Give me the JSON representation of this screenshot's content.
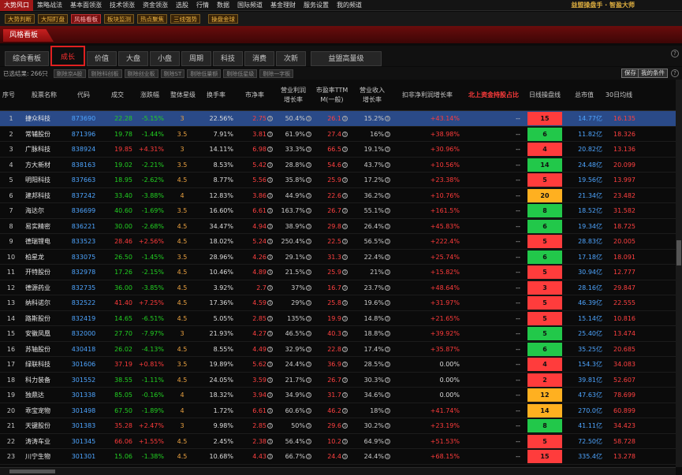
{
  "menu": [
    "大势风口",
    "策略战法",
    "基本面领涨",
    "技术领涨",
    "资金领涨",
    "选股",
    "行情",
    "数据",
    "国际频道",
    "基金理财",
    "服务设置",
    "我的频道"
  ],
  "menu_active_index": 0,
  "brand": "益盟操盘手 · 智盈大师",
  "toolbar": [
    {
      "label": "大势判断",
      "style": "gold"
    },
    {
      "label": "大阳盯盘",
      "style": "gold"
    },
    {
      "label": "风格看板",
      "style": "red"
    },
    {
      "label": "板块监测",
      "style": "gold"
    },
    {
      "label": "热点聚焦",
      "style": "gold"
    },
    {
      "label": "三线强势",
      "style": "gold"
    },
    {
      "label": "操盘金球",
      "style": "gold"
    }
  ],
  "page_tab": "风格看板",
  "tabs": [
    "综合看板",
    "成长",
    "价值",
    "大盘",
    "小盘",
    "周期",
    "科技",
    "消费",
    "次新",
    "益盟高量级"
  ],
  "active_tab_index": 1,
  "filter": {
    "selected_label": "已选结果: 266只",
    "buttons": [
      "剔除京A股",
      "剔除科创板",
      "剔除创业板",
      "剔除ST",
      "剔除低量额",
      "剔除低星级",
      "剔除一字板"
    ],
    "save_label": "保存",
    "conditions_label": "我的条件"
  },
  "columns": {
    "idx": "序号",
    "name": "股票名称",
    "code": "代码",
    "price": "成交",
    "pct": "涨跌幅",
    "star": "整体星级",
    "turnover": "换手率",
    "pb": "市净率",
    "profit_growth": "营业利润\n增长率",
    "pe": "市盈率TTM\nM(一般)",
    "revenue_growth": "营业收入\n增长率",
    "net_profit_growth": "扣非净利润增长率",
    "north_hold": "北上资金持股占比",
    "day_line": "日线操盘线",
    "market_cap": "总市值",
    "ma30": "30日均线"
  },
  "colors": {
    "up": "#ff3b3b",
    "down": "#22d022",
    "line_red": "#ff3c3c",
    "line_orange": "#ffb020",
    "line_green": "#22c84a",
    "code_blue": "#4ea5ff",
    "selected_row": "#2a4a88"
  },
  "selected_row_index": 0,
  "rows": [
    {
      "idx": "1",
      "name": "捷众科技",
      "code": "873690",
      "price": "22.28",
      "pct": "-5.15%",
      "star": "3",
      "turnover": "22.56%",
      "pb": "2.75",
      "profit_growth": "50.4%",
      "pe": "26.1",
      "revenue_growth": "15.2%",
      "net_profit_growth": "+43.14%",
      "north": "--",
      "day_line": "15",
      "day_line_color": "red",
      "market_cap": "14.77亿",
      "ma30": "16.135"
    },
    {
      "idx": "2",
      "name": "常辅股份",
      "code": "871396",
      "price": "19.78",
      "pct": "-1.44%",
      "star": "3.5",
      "turnover": "7.91%",
      "pb": "3.81",
      "profit_growth": "61.9%",
      "pe": "27.4",
      "revenue_growth": "16%",
      "net_profit_growth": "+38.98%",
      "north": "--",
      "day_line": "6",
      "day_line_color": "green",
      "market_cap": "11.82亿",
      "ma30": "18.326"
    },
    {
      "idx": "3",
      "name": "广脉科技",
      "code": "838924",
      "price": "19.85",
      "pct": "+4.31%",
      "star": "3",
      "turnover": "14.11%",
      "pb": "6.98",
      "profit_growth": "33.3%",
      "pe": "66.5",
      "revenue_growth": "19.1%",
      "net_profit_growth": "+30.96%",
      "north": "--",
      "day_line": "4",
      "day_line_color": "red",
      "market_cap": "20.82亿",
      "ma30": "13.136"
    },
    {
      "idx": "4",
      "name": "方大新材",
      "code": "838163",
      "price": "19.02",
      "pct": "-2.21%",
      "star": "3.5",
      "turnover": "8.53%",
      "pb": "5.42",
      "profit_growth": "28.8%",
      "pe": "54.6",
      "revenue_growth": "43.7%",
      "net_profit_growth": "+10.56%",
      "north": "--",
      "day_line": "14",
      "day_line_color": "green",
      "market_cap": "24.48亿",
      "ma30": "20.099"
    },
    {
      "idx": "5",
      "name": "明阳科技",
      "code": "837663",
      "price": "18.95",
      "pct": "-2.62%",
      "star": "4.5",
      "turnover": "8.77%",
      "pb": "5.56",
      "profit_growth": "35.8%",
      "pe": "25.9",
      "revenue_growth": "17.2%",
      "net_profit_growth": "+23.38%",
      "north": "--",
      "day_line": "5",
      "day_line_color": "red",
      "market_cap": "19.56亿",
      "ma30": "13.997"
    },
    {
      "idx": "6",
      "name": "建邦科技",
      "code": "837242",
      "price": "33.40",
      "pct": "-3.88%",
      "star": "4",
      "turnover": "12.83%",
      "pb": "3.86",
      "profit_growth": "44.9%",
      "pe": "22.6",
      "revenue_growth": "36.2%",
      "net_profit_growth": "+10.76%",
      "north": "--",
      "day_line": "20",
      "day_line_color": "orange",
      "market_cap": "21.34亿",
      "ma30": "23.482"
    },
    {
      "idx": "7",
      "name": "海达尔",
      "code": "836699",
      "price": "40.60",
      "pct": "-1.69%",
      "star": "3.5",
      "turnover": "16.60%",
      "pb": "6.61",
      "profit_growth": "163.7%",
      "pe": "26.7",
      "revenue_growth": "55.1%",
      "net_profit_growth": "+161.5%",
      "north": "--",
      "day_line": "8",
      "day_line_color": "green",
      "market_cap": "18.52亿",
      "ma30": "31.582"
    },
    {
      "idx": "8",
      "name": "易实精密",
      "code": "836221",
      "price": "30.00",
      "pct": "-2.68%",
      "star": "4.5",
      "turnover": "34.47%",
      "pb": "4.94",
      "profit_growth": "38.9%",
      "pe": "29.8",
      "revenue_growth": "26.4%",
      "net_profit_growth": "+45.83%",
      "north": "--",
      "day_line": "6",
      "day_line_color": "green",
      "market_cap": "19.34亿",
      "ma30": "18.725"
    },
    {
      "idx": "9",
      "name": "德瑞锂电",
      "code": "833523",
      "price": "28.46",
      "pct": "+2.56%",
      "star": "4.5",
      "turnover": "18.02%",
      "pb": "5.24",
      "profit_growth": "250.4%",
      "pe": "22.5",
      "revenue_growth": "56.5%",
      "net_profit_growth": "+222.4%",
      "north": "--",
      "day_line": "5",
      "day_line_color": "red",
      "market_cap": "28.83亿",
      "ma30": "20.005"
    },
    {
      "idx": "10",
      "name": "柏星龙",
      "code": "833075",
      "price": "26.50",
      "pct": "-1.45%",
      "star": "3.5",
      "turnover": "28.96%",
      "pb": "4.26",
      "profit_growth": "29.1%",
      "pe": "31.3",
      "revenue_growth": "22.4%",
      "net_profit_growth": "+25.74%",
      "north": "--",
      "day_line": "6",
      "day_line_color": "green",
      "market_cap": "17.18亿",
      "ma30": "18.091"
    },
    {
      "idx": "11",
      "name": "开特股份",
      "code": "832978",
      "price": "17.26",
      "pct": "-2.15%",
      "star": "4.5",
      "turnover": "10.46%",
      "pb": "4.89",
      "profit_growth": "21.5%",
      "pe": "25.9",
      "revenue_growth": "21%",
      "net_profit_growth": "+15.82%",
      "north": "--",
      "day_line": "5",
      "day_line_color": "red",
      "market_cap": "30.94亿",
      "ma30": "12.777"
    },
    {
      "idx": "12",
      "name": "德源药业",
      "code": "832735",
      "price": "36.00",
      "pct": "-3.85%",
      "star": "4.5",
      "turnover": "3.92%",
      "pb": "2.7",
      "profit_growth": "37%",
      "pe": "16.7",
      "revenue_growth": "23.7%",
      "net_profit_growth": "+48.64%",
      "north": "--",
      "day_line": "3",
      "day_line_color": "red",
      "market_cap": "28.16亿",
      "ma30": "29.847"
    },
    {
      "idx": "13",
      "name": "纳科诺尔",
      "code": "832522",
      "price": "41.40",
      "pct": "+7.25%",
      "star": "4.5",
      "turnover": "17.36%",
      "pb": "4.59",
      "profit_growth": "29%",
      "pe": "25.8",
      "revenue_growth": "19.6%",
      "net_profit_growth": "+31.97%",
      "north": "--",
      "day_line": "5",
      "day_line_color": "red",
      "market_cap": "46.39亿",
      "ma30": "22.555"
    },
    {
      "idx": "14",
      "name": "路斯股份",
      "code": "832419",
      "price": "14.65",
      "pct": "-6.51%",
      "star": "4.5",
      "turnover": "5.05%",
      "pb": "2.85",
      "profit_growth": "135%",
      "pe": "19.9",
      "revenue_growth": "14.8%",
      "net_profit_growth": "+21.65%",
      "north": "--",
      "day_line": "5",
      "day_line_color": "red",
      "market_cap": "15.14亿",
      "ma30": "10.816"
    },
    {
      "idx": "15",
      "name": "安徽凤凰",
      "code": "832000",
      "price": "27.70",
      "pct": "-7.97%",
      "star": "3",
      "turnover": "21.93%",
      "pb": "4.27",
      "profit_growth": "46.5%",
      "pe": "40.3",
      "revenue_growth": "18.8%",
      "net_profit_growth": "+39.92%",
      "north": "--",
      "day_line": "5",
      "day_line_color": "green",
      "market_cap": "25.40亿",
      "ma30": "13.474"
    },
    {
      "idx": "16",
      "name": "苏轴股份",
      "code": "430418",
      "price": "26.02",
      "pct": "-4.13%",
      "star": "4.5",
      "turnover": "8.55%",
      "pb": "4.49",
      "profit_growth": "32.9%",
      "pe": "22.8",
      "revenue_growth": "17.4%",
      "net_profit_growth": "+35.87%",
      "north": "--",
      "day_line": "6",
      "day_line_color": "green",
      "market_cap": "35.25亿",
      "ma30": "20.685"
    },
    {
      "idx": "17",
      "name": "绿联科技",
      "code": "301606",
      "price": "37.19",
      "pct": "+0.81%",
      "star": "3.5",
      "turnover": "19.89%",
      "pb": "5.62",
      "profit_growth": "24.4%",
      "pe": "36.9",
      "revenue_growth": "28.5%",
      "net_profit_growth": "0.00%",
      "north": "--",
      "day_line": "4",
      "day_line_color": "red",
      "market_cap": "154.3亿",
      "ma30": "34.083"
    },
    {
      "idx": "18",
      "name": "科力装备",
      "code": "301552",
      "price": "38.55",
      "pct": "-1.11%",
      "star": "4.5",
      "turnover": "24.05%",
      "pb": "3.59",
      "profit_growth": "21.7%",
      "pe": "26.7",
      "revenue_growth": "30.3%",
      "net_profit_growth": "0.00%",
      "north": "--",
      "day_line": "2",
      "day_line_color": "red",
      "market_cap": "39.81亿",
      "ma30": "52.607"
    },
    {
      "idx": "19",
      "name": "独鼎达",
      "code": "301338",
      "price": "85.05",
      "pct": "-0.16%",
      "star": "4",
      "turnover": "18.32%",
      "pb": "3.94",
      "profit_growth": "34.9%",
      "pe": "31.7",
      "revenue_growth": "34.6%",
      "net_profit_growth": "0.00%",
      "north": "--",
      "day_line": "12",
      "day_line_color": "orange",
      "market_cap": "47.63亿",
      "ma30": "78.699"
    },
    {
      "idx": "20",
      "name": "乖宝宠物",
      "code": "301498",
      "price": "67.50",
      "pct": "-1.89%",
      "star": "4",
      "turnover": "1.72%",
      "pb": "6.61",
      "profit_growth": "60.6%",
      "pe": "46.2",
      "revenue_growth": "18%",
      "net_profit_growth": "+41.74%",
      "north": "--",
      "day_line": "14",
      "day_line_color": "orange",
      "market_cap": "270.0亿",
      "ma30": "60.899"
    },
    {
      "idx": "21",
      "name": "天键股份",
      "code": "301383",
      "price": "35.28",
      "pct": "+2.47%",
      "star": "3",
      "turnover": "9.98%",
      "pb": "2.85",
      "profit_growth": "50%",
      "pe": "29.6",
      "revenue_growth": "30.2%",
      "net_profit_growth": "+23.19%",
      "north": "--",
      "day_line": "8",
      "day_line_color": "green",
      "market_cap": "41.11亿",
      "ma30": "34.423"
    },
    {
      "idx": "22",
      "name": "涛涛车业",
      "code": "301345",
      "price": "66.06",
      "pct": "+1.55%",
      "star": "4.5",
      "turnover": "2.45%",
      "pb": "2.38",
      "profit_growth": "56.4%",
      "pe": "10.2",
      "revenue_growth": "64.9%",
      "net_profit_growth": "+51.53%",
      "north": "--",
      "day_line": "5",
      "day_line_color": "red",
      "market_cap": "72.50亿",
      "ma30": "58.728"
    },
    {
      "idx": "23",
      "name": "川宁生物",
      "code": "301301",
      "price": "15.06",
      "pct": "-1.38%",
      "star": "4.5",
      "turnover": "10.68%",
      "pb": "4.43",
      "profit_growth": "66.7%",
      "pe": "24.4",
      "revenue_growth": "24.4%",
      "net_profit_growth": "+68.15%",
      "north": "--",
      "day_line": "15",
      "day_line_color": "red",
      "market_cap": "335.4亿",
      "ma30": "13.278"
    }
  ]
}
